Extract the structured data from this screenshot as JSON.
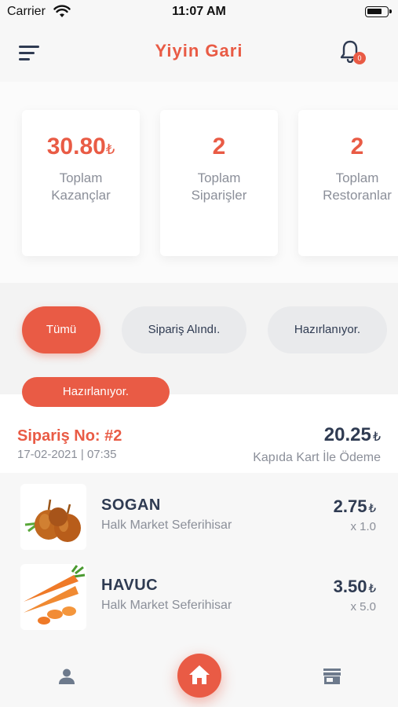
{
  "status_bar": {
    "carrier": "Carrier",
    "time": "11:07 AM"
  },
  "header": {
    "title": "Yiyin Gari",
    "notification_count": "0"
  },
  "stats": [
    {
      "value": "30.80",
      "currency": "₺",
      "label": "Toplam Kazançlar"
    },
    {
      "value": "2",
      "currency": "",
      "label": "Toplam Siparişler"
    },
    {
      "value": "2",
      "currency": "",
      "label": "Toplam Restoranlar"
    }
  ],
  "filters": [
    {
      "label": "Tümü",
      "active": true
    },
    {
      "label": "Sipariş Alındı.",
      "active": false
    },
    {
      "label": "Hazırlanıyor.",
      "active": false
    }
  ],
  "order": {
    "status": "Hazırlanıyor.",
    "number": "Sipariş No: #2",
    "date": "17-02-2021 | 07:35",
    "total": "20.25",
    "currency": "₺",
    "payment": "Kapıda Kart İle Ödeme",
    "items": [
      {
        "name": "SOGAN",
        "store": "Halk Market Seferihisar",
        "price": "2.75",
        "currency": "₺",
        "qty": "x 1.0",
        "image": "onion-image"
      },
      {
        "name": "HAVUC",
        "store": "Halk Market Seferihisar",
        "price": "3.50",
        "currency": "₺",
        "qty": "x 5.0",
        "image": "carrot-image"
      }
    ]
  },
  "tabbar": {
    "left": "profile-icon",
    "center": "home-icon",
    "right": "store-icon"
  },
  "colors": {
    "accent": "#e95b45",
    "text": "#2f3b52",
    "muted": "#8b8f99"
  }
}
